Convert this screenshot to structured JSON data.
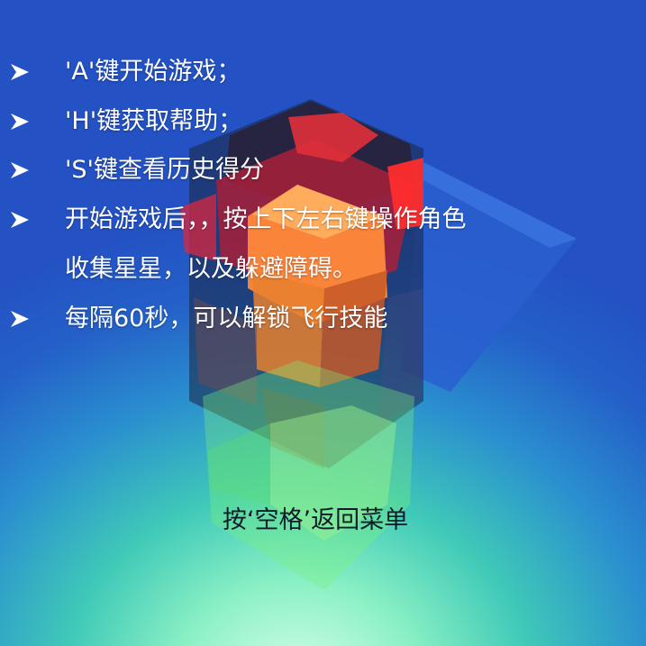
{
  "instructions": [
    {
      "text": "'A'键开始游戏；"
    },
    {
      "text": "'H'键获取帮助；"
    },
    {
      "text": "'S'键查看历史得分"
    },
    {
      "text": "开始游戏后，，按上下左右键操作角色"
    },
    {
      "continuation": "收集星星，以及躲避障碍。"
    },
    {
      "text": "每隔60秒，可以解锁飞行技能"
    }
  ],
  "bullet_icon": "arrowhead-bullet-icon",
  "back_hint": "按‘空格’返回菜单",
  "colors": {
    "background_top": "#2452c4",
    "background_bottom": "#8af0c4",
    "text": "#ffffff",
    "hint_text": "#0f1d2a",
    "cube_red": "#ff2d2d",
    "cube_orange": "#ff8a3a",
    "cube_blue": "#2a5fd0",
    "cube_green": "#7cf07a"
  }
}
